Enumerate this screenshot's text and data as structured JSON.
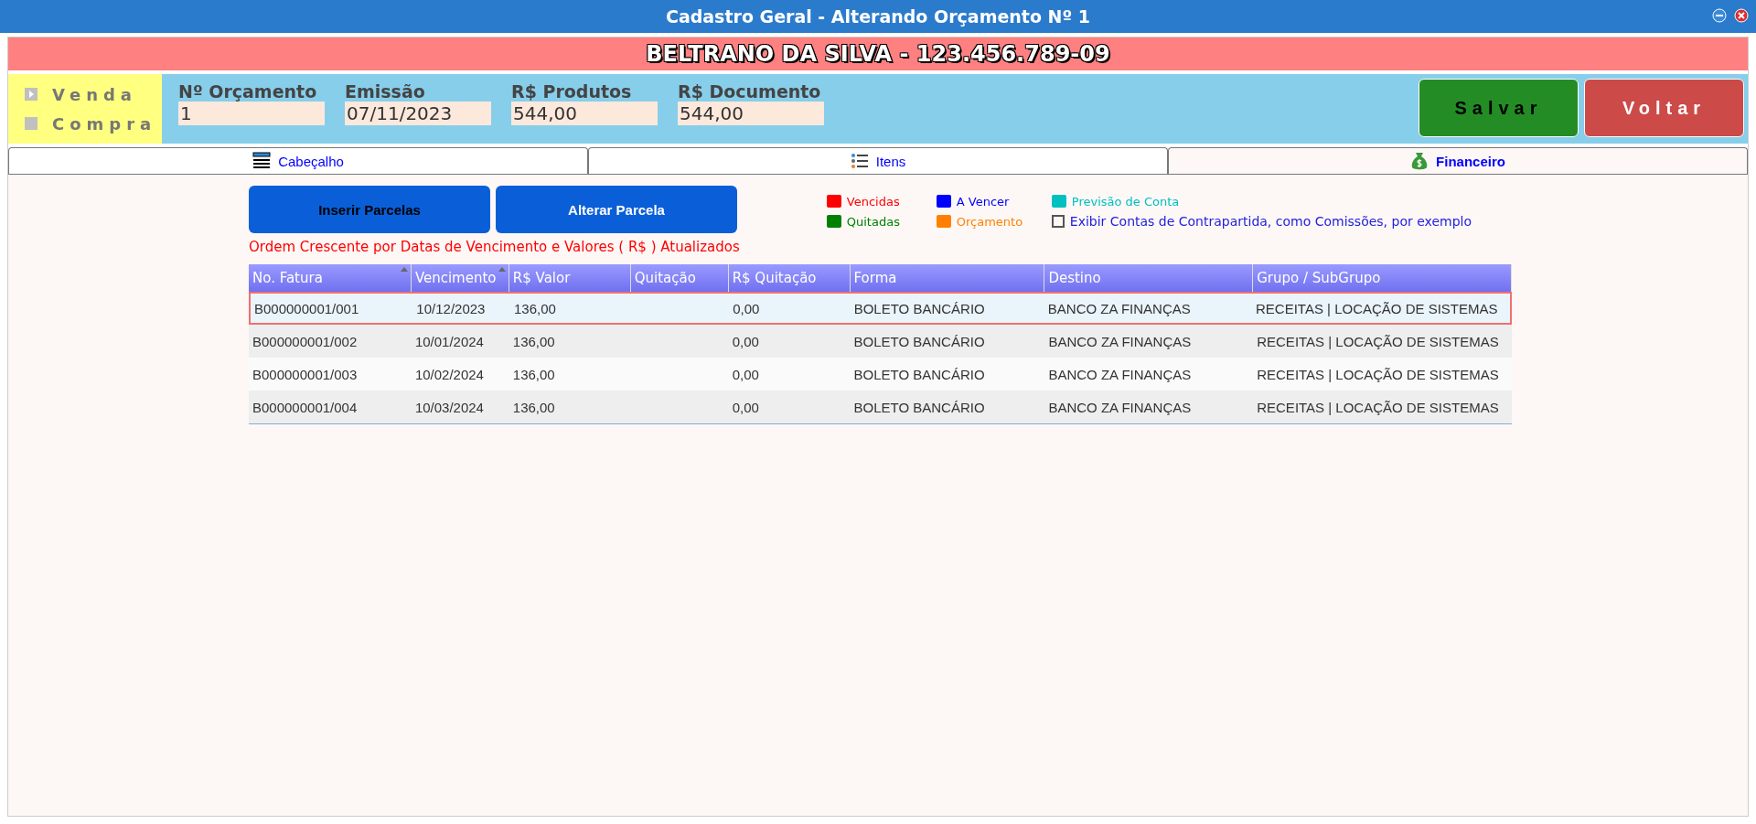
{
  "window": {
    "title": "Cadastro Geral - Alterando Orçamento Nº 1"
  },
  "client_banner": "BELTRANO DA SILVA - 123.456.789-09",
  "operation": [
    {
      "label": "Venda",
      "selected": true
    },
    {
      "label": "Compra",
      "selected": false
    }
  ],
  "fields": [
    {
      "label": "Nº Orçamento",
      "value": "1"
    },
    {
      "label": "Emissão",
      "value": "07/11/2023"
    },
    {
      "label": "R$ Produtos",
      "value": "544,00"
    },
    {
      "label": "R$ Documento",
      "value": "544,00"
    }
  ],
  "actions": [
    {
      "label": "Salvar",
      "kind": "save"
    },
    {
      "label": "Voltar",
      "kind": "back"
    }
  ],
  "tabs": [
    {
      "label": "Cabeçalho",
      "kind": "header",
      "selected": false
    },
    {
      "label": "Itens",
      "kind": "list",
      "selected": false
    },
    {
      "label": "Financeiro",
      "kind": "money",
      "selected": true
    }
  ],
  "buttons": [
    "Inserir Parcelas",
    "Alterar Parcela"
  ],
  "legend": [
    {
      "label": "Vencidas",
      "color": "#ff0000"
    },
    {
      "label": "Quitadas",
      "color": "#008000"
    },
    {
      "label": "A Vencer",
      "color": "#0000ff"
    },
    {
      "label": "Orçamento",
      "color": "#ff8000"
    },
    {
      "label": "Previsão de Conta",
      "color": "#00c0c0"
    }
  ],
  "show_counterpart": {
    "label": "Exibir Contas de Contrapartida, como Comissões, por exemplo",
    "checked": false
  },
  "sort_note": "Ordem Crescente por Datas de Vencimento e Valores ( R$ ) Atualizados",
  "table": {
    "columns": [
      {
        "label": "No. Fatura",
        "sorted": true
      },
      {
        "label": "Vencimento",
        "sorted": true
      },
      {
        "label": "R$ Valor",
        "sorted": false
      },
      {
        "label": "Quitação",
        "sorted": false
      },
      {
        "label": "R$ Quitação",
        "sorted": false
      },
      {
        "label": "Forma",
        "sorted": false
      },
      {
        "label": "Destino",
        "sorted": false
      },
      {
        "label": "Grupo / SubGrupo",
        "sorted": false
      }
    ],
    "rows": [
      {
        "selected": true,
        "cells": [
          "B000000001/001",
          "10/12/2023",
          "136,00",
          "",
          "0,00",
          "BOLETO BANCÁRIO",
          "BANCO ZA FINANÇAS",
          "RECEITAS | LOCAÇÃO DE SISTEMAS"
        ]
      },
      {
        "selected": false,
        "cells": [
          "B000000001/002",
          "10/01/2024",
          "136,00",
          "",
          "0,00",
          "BOLETO BANCÁRIO",
          "BANCO ZA FINANÇAS",
          "RECEITAS | LOCAÇÃO DE SISTEMAS"
        ]
      },
      {
        "selected": false,
        "cells": [
          "B000000001/003",
          "10/02/2024",
          "136,00",
          "",
          "0,00",
          "BOLETO BANCÁRIO",
          "BANCO ZA FINANÇAS",
          "RECEITAS | LOCAÇÃO DE SISTEMAS"
        ]
      },
      {
        "selected": false,
        "cells": [
          "B000000001/004",
          "10/03/2024",
          "136,00",
          "",
          "0,00",
          "BOLETO BANCÁRIO",
          "BANCO ZA FINANÇAS",
          "RECEITAS | LOCAÇÃO DE SISTEMAS"
        ]
      }
    ]
  }
}
